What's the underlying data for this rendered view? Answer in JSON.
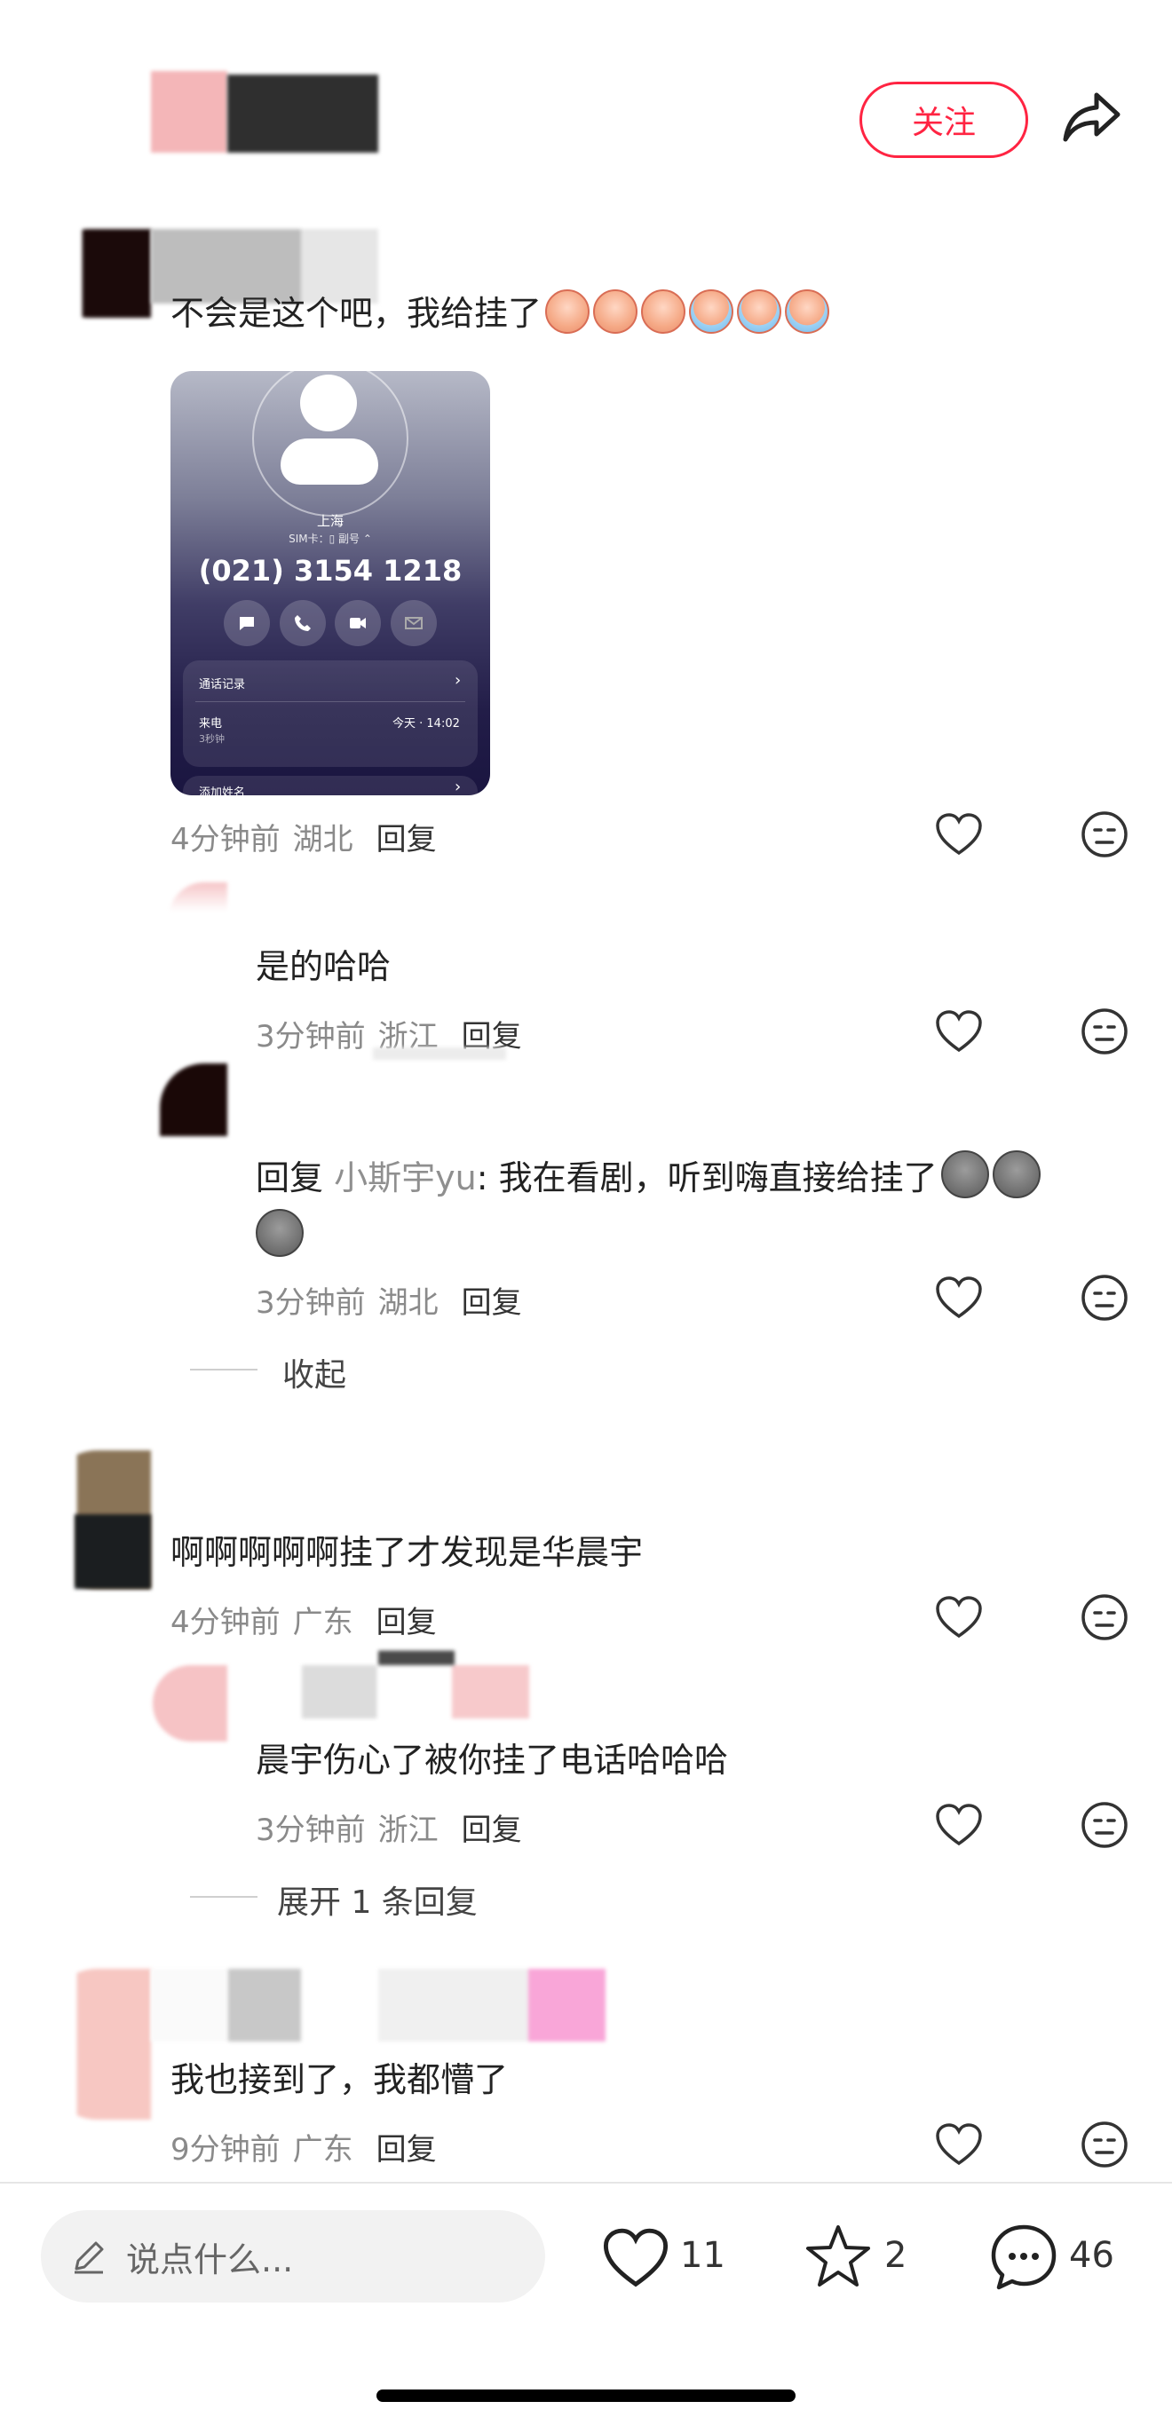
{
  "header": {
    "follow_label": "关注",
    "share_icon": "share-icon"
  },
  "comments": [
    {
      "text": "不会是这个吧，我给挂了",
      "time": "4分钟前",
      "location": "湖北",
      "reply_label": "回复",
      "image": {
        "city": "上海",
        "sim_line": "SIM卡：▯ 副号 ⌃",
        "number": "(021) 3154 1218",
        "call_log_label": "通话记录",
        "incoming_label": "来电",
        "duration": "3秒钟",
        "incoming_time": "今天 · 14:02",
        "add_name_label": "添加姓名"
      }
    },
    {
      "text": "是的哈哈",
      "time": "3分钟前",
      "location": "浙江",
      "reply_label": "回复"
    },
    {
      "reply_prefix": "回复",
      "mention": "小斯宇yu",
      "text_line1": ": 我在看剧，听到嗨直接给挂了",
      "time": "3分钟前",
      "location": "湖北",
      "reply_label": "回复"
    },
    {
      "collapse_label": "收起"
    },
    {
      "text": "啊啊啊啊啊挂了才发现是华晨宇",
      "time": "4分钟前",
      "location": "广东",
      "reply_label": "回复"
    },
    {
      "text": "晨宇伤心了被你挂了电话哈哈哈",
      "time": "3分钟前",
      "location": "浙江",
      "reply_label": "回复"
    },
    {
      "expand_label": "展开 1 条回复"
    },
    {
      "text": "我也接到了，我都懵了",
      "time": "9分钟前",
      "location": "广东",
      "reply_label": "回复"
    }
  ],
  "bottom_bar": {
    "input_placeholder": "说点什么...",
    "like_count": "11",
    "star_count": "2",
    "comment_count": "46"
  },
  "colors": {
    "accent": "#ff2442",
    "meta_text": "#8a8a8a"
  }
}
